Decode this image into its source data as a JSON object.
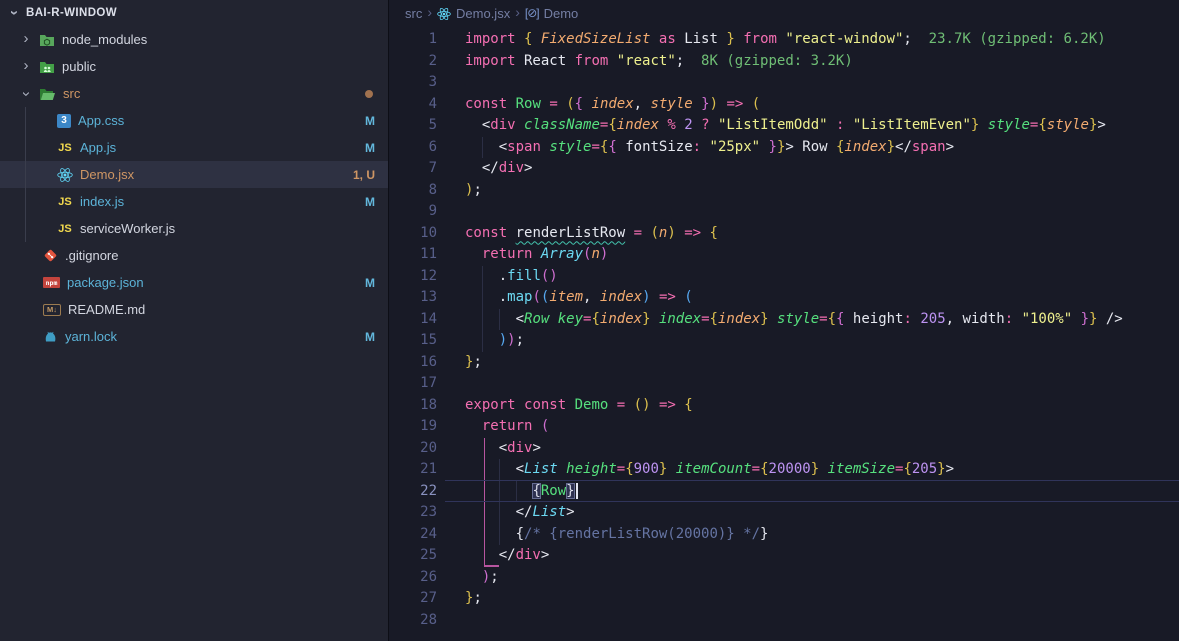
{
  "colors": {
    "ebg": "#181a26",
    "sbg": "#222430",
    "sel": "#2e3142",
    "div": "#0d0e16",
    "wh": "#e6e8f0",
    "kw": "#f46fb2",
    "str": "#eef08e",
    "num": "#bd93f2",
    "grn": "#56e07e",
    "cy": "#6cd9f2",
    "or": "#f3ab70",
    "cmt": "#6574a3",
    "cost": "#6fbe75",
    "bg_br": "#dcc04e",
    "bp_br": "#cf6fd0",
    "bb_br": "#57a9f2",
    "ln": "#585f8a",
    "lnactive": "#8a92c0",
    "aline": "#30345a",
    "gpink": "#b7559f",
    "gg": "#2b2e44",
    "squig": "#43c3ad",
    "fileblue": "#5cb3d8",
    "fileorange": "#cf9664",
    "filedefault": "#d3d6e0",
    "badgeblue": "#63b8dd",
    "dot": "#a1724f",
    "bc": "#747ea3",
    "react": "#61dafb"
  },
  "sidebar": {
    "title": "BAI-R-WINDOW",
    "items": [
      {
        "type": "folder",
        "label": "node_modules",
        "icon": "folder-node-icon",
        "chevron": "right",
        "indent": 1,
        "color": ""
      },
      {
        "type": "folder",
        "label": "public",
        "icon": "folder-public-icon",
        "chevron": "right",
        "indent": 1,
        "color": ""
      },
      {
        "type": "folder",
        "label": "src",
        "icon": "folder-src-open-icon",
        "chevron": "down",
        "indent": 1,
        "color": "orange",
        "badge": "dot"
      },
      {
        "type": "file",
        "label": "App.css",
        "icon": "css-icon",
        "indent": 2,
        "color": "blue",
        "badge": "M"
      },
      {
        "type": "file",
        "label": "App.js",
        "icon": "js-icon",
        "indent": 2,
        "color": "blue",
        "badge": "M"
      },
      {
        "type": "file",
        "label": "Demo.jsx",
        "icon": "react-icon",
        "indent": 2,
        "color": "orange",
        "badge": "1, U",
        "selected": true
      },
      {
        "type": "file",
        "label": "index.js",
        "icon": "js-icon",
        "indent": 2,
        "color": "blue",
        "badge": "M"
      },
      {
        "type": "file",
        "label": "serviceWorker.js",
        "icon": "js-icon",
        "indent": 2,
        "color": ""
      },
      {
        "type": "file",
        "label": ".gitignore",
        "icon": "git-icon",
        "indent": 1,
        "color": ""
      },
      {
        "type": "file",
        "label": "package.json",
        "icon": "npm-icon",
        "indent": 1,
        "color": "blue",
        "badge": "M"
      },
      {
        "type": "file",
        "label": "README.md",
        "icon": "markdown-icon",
        "indent": 1,
        "color": ""
      },
      {
        "type": "file",
        "label": "yarn.lock",
        "icon": "yarn-icon",
        "indent": 1,
        "color": "blue",
        "badge": "M"
      }
    ]
  },
  "breadcrumb": {
    "crumbs": [
      {
        "label": "src"
      },
      {
        "label": "Demo.jsx"
      },
      {
        "label": "Demo"
      }
    ],
    "symbol_glyph": "[⊘]"
  },
  "editor": {
    "active_line": 22,
    "lines": [
      [
        [
          "import ",
          "kw"
        ],
        [
          "{",
          "bg"
        ],
        [
          " ",
          "wh"
        ],
        [
          "FixedSizeList",
          "or"
        ],
        [
          " ",
          "wh"
        ],
        [
          "as",
          "kw"
        ],
        [
          " List ",
          "wh"
        ],
        [
          "}",
          "bg"
        ],
        [
          " ",
          "wh"
        ],
        [
          "from",
          "kw"
        ],
        [
          " ",
          "wh"
        ],
        [
          "\"react-window\"",
          "str"
        ],
        [
          ";",
          "wh"
        ],
        [
          "  23.7K (gzipped: 6.2K)",
          "cost"
        ]
      ],
      [
        [
          "import",
          "kw"
        ],
        [
          " React ",
          "wh"
        ],
        [
          "from",
          "kw"
        ],
        [
          " ",
          "wh"
        ],
        [
          "\"react\"",
          "str"
        ],
        [
          ";",
          "wh"
        ],
        [
          "  8K (gzipped: 3.2K)",
          "cost"
        ]
      ],
      [],
      [
        [
          "const",
          "kw"
        ],
        [
          " ",
          "wh"
        ],
        [
          "Row",
          "grn"
        ],
        [
          " ",
          "wh"
        ],
        [
          "=",
          "kw"
        ],
        [
          " ",
          "wh"
        ],
        [
          "(",
          "bg"
        ],
        [
          "{",
          "bp"
        ],
        [
          " ",
          "wh"
        ],
        [
          "index",
          "or"
        ],
        [
          ", ",
          "wh"
        ],
        [
          "style",
          "or"
        ],
        [
          " ",
          "wh"
        ],
        [
          "}",
          "bp"
        ],
        [
          ")",
          "bg"
        ],
        [
          " ",
          "wh"
        ],
        [
          "=>",
          "kw"
        ],
        [
          " ",
          "wh"
        ],
        [
          "(",
          "bg"
        ]
      ],
      [
        [
          "  <",
          "wh"
        ],
        [
          "div",
          "tag"
        ],
        [
          " ",
          "wh"
        ],
        [
          "className",
          "grni"
        ],
        [
          "=",
          "kw"
        ],
        [
          "{",
          "bg"
        ],
        [
          "index",
          "or"
        ],
        [
          " ",
          "wh"
        ],
        [
          "%",
          "kw"
        ],
        [
          " ",
          "wh"
        ],
        [
          "2",
          "num"
        ],
        [
          " ",
          "wh"
        ],
        [
          "?",
          "kw"
        ],
        [
          " ",
          "wh"
        ],
        [
          "\"ListItemOdd\"",
          "str"
        ],
        [
          " ",
          "wh"
        ],
        [
          ":",
          "kw"
        ],
        [
          " ",
          "wh"
        ],
        [
          "\"ListItemEven\"",
          "str"
        ],
        [
          "}",
          "bg"
        ],
        [
          " ",
          "wh"
        ],
        [
          "style",
          "grni"
        ],
        [
          "=",
          "kw"
        ],
        [
          "{",
          "bg"
        ],
        [
          "style",
          "or"
        ],
        [
          "}",
          "bg"
        ],
        [
          ">",
          "wh"
        ]
      ],
      [
        [
          "    <",
          "wh"
        ],
        [
          "span",
          "tag"
        ],
        [
          " ",
          "wh"
        ],
        [
          "style",
          "grni"
        ],
        [
          "=",
          "kw"
        ],
        [
          "{",
          "bg"
        ],
        [
          "{",
          "bp"
        ],
        [
          " fontSize",
          "wh"
        ],
        [
          ":",
          "kw"
        ],
        [
          " ",
          "wh"
        ],
        [
          "\"25px\"",
          "str"
        ],
        [
          " ",
          "wh"
        ],
        [
          "}",
          "bp"
        ],
        [
          "}",
          "bg"
        ],
        [
          "> Row ",
          "wh"
        ],
        [
          "{",
          "bg"
        ],
        [
          "index",
          "or"
        ],
        [
          "}",
          "bg"
        ],
        [
          "</",
          "wh"
        ],
        [
          "span",
          "tag"
        ],
        [
          ">",
          "wh"
        ]
      ],
      [
        [
          "  </",
          "wh"
        ],
        [
          "div",
          "tag"
        ],
        [
          ">",
          "wh"
        ]
      ],
      [
        [
          ")",
          "bg"
        ],
        [
          ";",
          "wh"
        ]
      ],
      [],
      [
        [
          "const",
          "kw"
        ],
        [
          " ",
          "wh"
        ],
        [
          "renderListRow",
          "sq"
        ],
        [
          " ",
          "wh"
        ],
        [
          "=",
          "kw"
        ],
        [
          " ",
          "wh"
        ],
        [
          "(",
          "bg"
        ],
        [
          "n",
          "or"
        ],
        [
          ")",
          "bg"
        ],
        [
          " ",
          "wh"
        ],
        [
          "=>",
          "kw"
        ],
        [
          " ",
          "wh"
        ],
        [
          "{",
          "bg"
        ]
      ],
      [
        [
          "  ",
          "wh"
        ],
        [
          "return",
          "kw"
        ],
        [
          " ",
          "wh"
        ],
        [
          "Array",
          "cyi"
        ],
        [
          "(",
          "bp"
        ],
        [
          "n",
          "or"
        ],
        [
          ")",
          "bp"
        ]
      ],
      [
        [
          "    .",
          "wh"
        ],
        [
          "fill",
          "cy"
        ],
        [
          "()",
          "bp"
        ]
      ],
      [
        [
          "    .",
          "wh"
        ],
        [
          "map",
          "cy"
        ],
        [
          "(",
          "bp"
        ],
        [
          "(",
          "bb"
        ],
        [
          "item",
          "or"
        ],
        [
          ", ",
          "wh"
        ],
        [
          "index",
          "or"
        ],
        [
          ")",
          "bb"
        ],
        [
          " ",
          "wh"
        ],
        [
          "=>",
          "kw"
        ],
        [
          " ",
          "wh"
        ],
        [
          "(",
          "bb"
        ]
      ],
      [
        [
          "      <",
          "wh"
        ],
        [
          "Row",
          "grni"
        ],
        [
          " ",
          "wh"
        ],
        [
          "key",
          "grni"
        ],
        [
          "=",
          "kw"
        ],
        [
          "{",
          "bg"
        ],
        [
          "index",
          "or"
        ],
        [
          "}",
          "bg"
        ],
        [
          " ",
          "wh"
        ],
        [
          "index",
          "grni"
        ],
        [
          "=",
          "kw"
        ],
        [
          "{",
          "bg"
        ],
        [
          "index",
          "or"
        ],
        [
          "}",
          "bg"
        ],
        [
          " ",
          "wh"
        ],
        [
          "style",
          "grni"
        ],
        [
          "=",
          "kw"
        ],
        [
          "{",
          "bg"
        ],
        [
          "{",
          "bp"
        ],
        [
          " height",
          "wh"
        ],
        [
          ":",
          "kw"
        ],
        [
          " ",
          "wh"
        ],
        [
          "205",
          "num"
        ],
        [
          ", width",
          "wh"
        ],
        [
          ":",
          "kw"
        ],
        [
          " ",
          "wh"
        ],
        [
          "\"100%\"",
          "str"
        ],
        [
          " ",
          "wh"
        ],
        [
          "}",
          "bp"
        ],
        [
          "}",
          "bg"
        ],
        [
          " />",
          "wh"
        ]
      ],
      [
        [
          "    ",
          "wh"
        ],
        [
          ")",
          "bb"
        ],
        [
          ")",
          "bp"
        ],
        [
          ";",
          "wh"
        ]
      ],
      [
        [
          "}",
          "bg"
        ],
        [
          ";",
          "wh"
        ]
      ],
      [],
      [
        [
          "export",
          "kw"
        ],
        [
          " ",
          "wh"
        ],
        [
          "const",
          "kw"
        ],
        [
          " ",
          "wh"
        ],
        [
          "Demo",
          "grn"
        ],
        [
          " ",
          "wh"
        ],
        [
          "=",
          "kw"
        ],
        [
          " ",
          "wh"
        ],
        [
          "()",
          "bg"
        ],
        [
          " ",
          "wh"
        ],
        [
          "=>",
          "kw"
        ],
        [
          " ",
          "wh"
        ],
        [
          "{",
          "bg"
        ]
      ],
      [
        [
          "  ",
          "wh"
        ],
        [
          "return",
          "kw"
        ],
        [
          " ",
          "wh"
        ],
        [
          "(",
          "bp"
        ]
      ],
      [
        [
          "    <",
          "wh"
        ],
        [
          "div",
          "tag"
        ],
        [
          ">",
          "wh"
        ]
      ],
      [
        [
          "      <",
          "wh"
        ],
        [
          "List",
          "cyi"
        ],
        [
          " ",
          "wh"
        ],
        [
          "height",
          "grni"
        ],
        [
          "=",
          "kw"
        ],
        [
          "{",
          "bg"
        ],
        [
          "900",
          "num"
        ],
        [
          "}",
          "bg"
        ],
        [
          " ",
          "wh"
        ],
        [
          "itemCount",
          "grni"
        ],
        [
          "=",
          "kw"
        ],
        [
          "{",
          "bg"
        ],
        [
          "20000",
          "num"
        ],
        [
          "}",
          "bg"
        ],
        [
          " ",
          "wh"
        ],
        [
          "itemSize",
          "grni"
        ],
        [
          "=",
          "kw"
        ],
        [
          "{",
          "bg"
        ],
        [
          "205",
          "num"
        ],
        [
          "}",
          "bg"
        ],
        [
          ">",
          "wh"
        ]
      ],
      [
        [
          "        ",
          "wh"
        ],
        [
          "{",
          "mt"
        ],
        [
          "Row",
          "grn"
        ],
        [
          "}",
          "mt"
        ],
        [
          "",
          "cursor"
        ]
      ],
      [
        [
          "      </",
          "wh"
        ],
        [
          "List",
          "cyi"
        ],
        [
          ">",
          "wh"
        ]
      ],
      [
        [
          "      {",
          "wh"
        ],
        [
          "/* {renderListRow(20000)} */",
          "cmt"
        ],
        [
          "}",
          "wh"
        ]
      ],
      [
        [
          "    </",
          "wh"
        ],
        [
          "div",
          "tag"
        ],
        [
          ">",
          "wh"
        ]
      ],
      [
        [
          "  ",
          "wh"
        ],
        [
          ")",
          "bp"
        ],
        [
          ";",
          "wh"
        ]
      ],
      [
        [
          "}",
          "bg"
        ],
        [
          ";",
          "wh"
        ]
      ],
      []
    ]
  }
}
